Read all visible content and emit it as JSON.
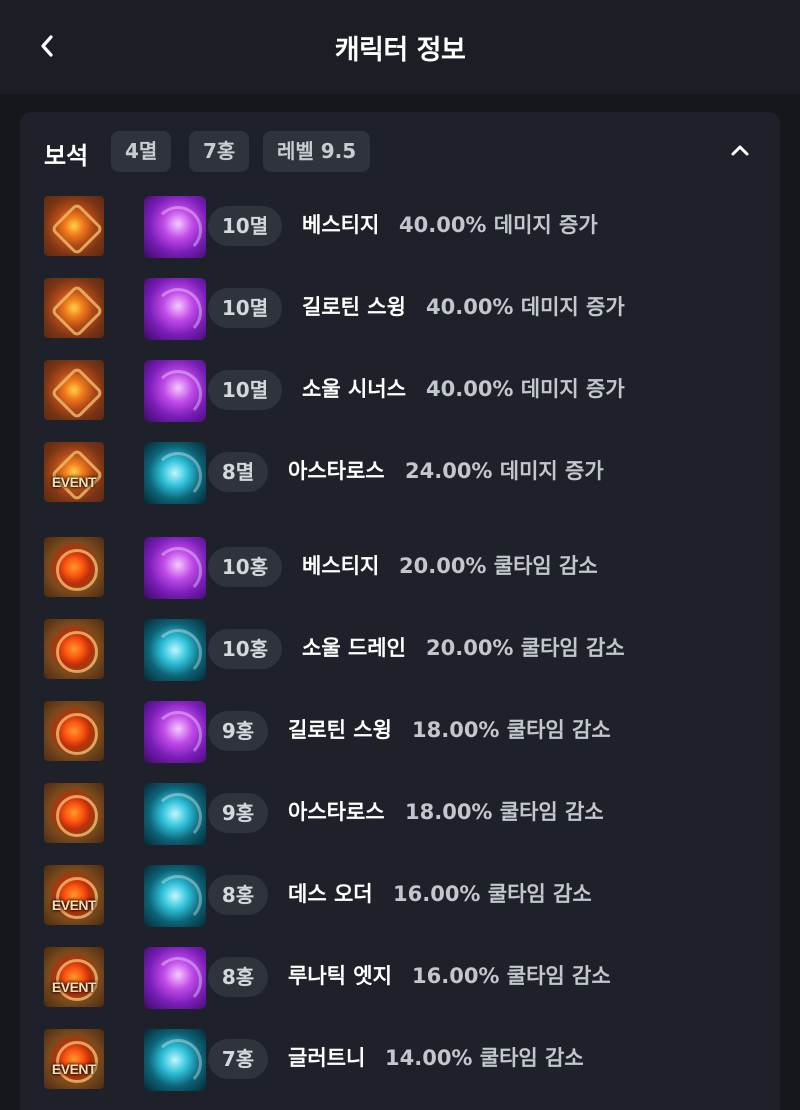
{
  "header": {
    "title": "캐릭터 정보",
    "back_icon": "chevron-left-icon"
  },
  "gems_section": {
    "title": "보석",
    "chips": [
      "4멸",
      "7홍",
      "레벨 9.5"
    ],
    "collapse_icon": "chevron-up-icon",
    "rows": [
      {
        "gem": "damage",
        "event": false,
        "skill_color": "purple",
        "level": "10멸",
        "skill": "베스티지",
        "effect": "40.00% 데미지 증가"
      },
      {
        "gem": "damage",
        "event": false,
        "skill_color": "purple",
        "level": "10멸",
        "skill": "길로틴 스윙",
        "effect": "40.00% 데미지 증가"
      },
      {
        "gem": "damage",
        "event": false,
        "skill_color": "purple",
        "level": "10멸",
        "skill": "소울 시너스",
        "effect": "40.00% 데미지 증가"
      },
      {
        "gem": "damage",
        "event": true,
        "skill_color": "teal",
        "level": "8멸",
        "skill": "아스타로스",
        "effect": "24.00% 데미지 증가"
      },
      {
        "gem": "cooldown",
        "event": false,
        "skill_color": "purple",
        "level": "10홍",
        "skill": "베스티지",
        "effect": "20.00% 쿨타임 감소"
      },
      {
        "gem": "cooldown",
        "event": false,
        "skill_color": "teal",
        "level": "10홍",
        "skill": "소울 드레인",
        "effect": "20.00% 쿨타임 감소"
      },
      {
        "gem": "cooldown",
        "event": false,
        "skill_color": "purple",
        "level": "9홍",
        "skill": "길로틴 스윙",
        "effect": "18.00% 쿨타임 감소"
      },
      {
        "gem": "cooldown",
        "event": false,
        "skill_color": "teal",
        "level": "9홍",
        "skill": "아스타로스",
        "effect": "18.00% 쿨타임 감소"
      },
      {
        "gem": "cooldown",
        "event": true,
        "skill_color": "teal",
        "level": "8홍",
        "skill": "데스 오더",
        "effect": "16.00% 쿨타임 감소"
      },
      {
        "gem": "cooldown",
        "event": true,
        "skill_color": "purple",
        "level": "8홍",
        "skill": "루나틱 엣지",
        "effect": "16.00% 쿨타임 감소"
      },
      {
        "gem": "cooldown",
        "event": true,
        "skill_color": "teal",
        "level": "7홍",
        "skill": "글러트니",
        "effect": "14.00% 쿨타임 감소"
      }
    ],
    "event_label": "EVENT"
  },
  "colors": {
    "background": "#15171c",
    "card": "#1e2129",
    "chip": "#2f333c",
    "effect_text": "#c3c6cd"
  }
}
